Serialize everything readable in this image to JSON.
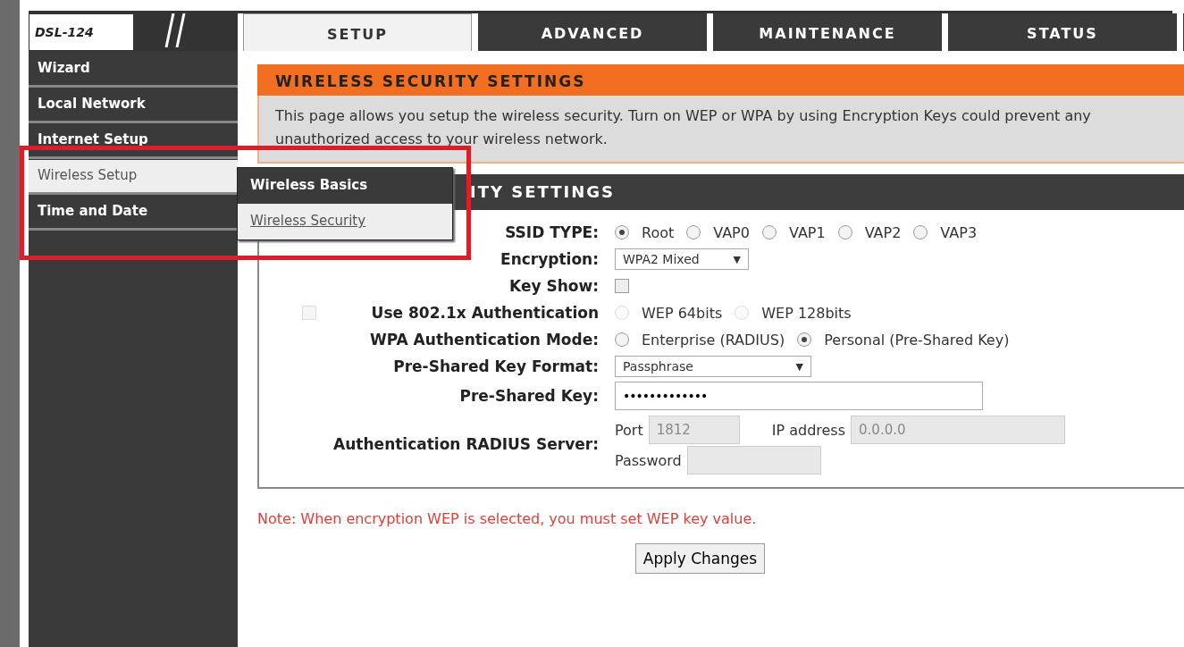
{
  "logo": {
    "model": "DSL-124"
  },
  "tabs": [
    {
      "label": "SETUP",
      "selected": true
    },
    {
      "label": "ADVANCED",
      "selected": false
    },
    {
      "label": "MAINTENANCE",
      "selected": false
    },
    {
      "label": "STATUS",
      "selected": false
    }
  ],
  "sidebar": {
    "items": [
      {
        "label": "Wizard",
        "selected": false
      },
      {
        "label": "Local Network",
        "selected": false
      },
      {
        "label": "Internet Setup",
        "selected": false
      },
      {
        "label": "Wireless Setup",
        "selected": true
      },
      {
        "label": "Time and Date",
        "selected": false
      }
    ]
  },
  "submenu": {
    "items": [
      {
        "label": "Wireless Basics",
        "selected": false
      },
      {
        "label": "Wireless Security",
        "selected": true
      }
    ]
  },
  "page_header": {
    "title": "WIRELESS SECURITY SETTINGS",
    "description": "This page allows you setup the wireless security. Turn on WEP or WPA by using Encryption Keys could prevent any unauthorized access to your wireless network."
  },
  "section": {
    "title": "ITY SETTINGS",
    "rows": [
      {
        "kind": "radios",
        "label": "SSID TYPE:",
        "options": [
          {
            "label": "Root",
            "selected": true,
            "disabled": false
          },
          {
            "label": "VAP0",
            "selected": false,
            "disabled": false
          },
          {
            "label": "VAP1",
            "selected": false,
            "disabled": false
          },
          {
            "label": "VAP2",
            "selected": false,
            "disabled": false
          },
          {
            "label": "VAP3",
            "selected": false,
            "disabled": false
          }
        ]
      },
      {
        "kind": "select",
        "label": "Encryption:",
        "value": "WPA2 Mixed",
        "arrow": "▼",
        "wide": false
      },
      {
        "kind": "checkbox",
        "label": "Key Show:",
        "checked": false,
        "disabled": false
      },
      {
        "kind": "radios",
        "label": "Use 802.1x Authentication",
        "check": {
          "checked": false,
          "disabled": true
        },
        "options": [
          {
            "label": "WEP 64bits",
            "selected": false,
            "disabled": true
          },
          {
            "label": "WEP 128bits",
            "selected": false,
            "disabled": true
          }
        ]
      },
      {
        "kind": "radios",
        "label": "WPA Authentication Mode:",
        "options": [
          {
            "label": "Enterprise (RADIUS)",
            "selected": false,
            "disabled": false
          },
          {
            "label": "Personal (Pre-Shared Key)",
            "selected": true,
            "disabled": false
          }
        ]
      },
      {
        "kind": "select",
        "label": "Pre-Shared Key Format:",
        "value": "Passphrase",
        "arrow": "▼",
        "wide": true
      },
      {
        "kind": "password",
        "label": "Pre-Shared Key:",
        "value": "•••••••••••••"
      },
      {
        "kind": "radius",
        "label": "Authentication RADIUS Server:",
        "port_label": "Port",
        "port": "1812",
        "ip_label": "IP address",
        "ip": "0.0.0.0",
        "password_label": "Password"
      }
    ]
  },
  "note": "Note: When encryption WEP is selected, you must set WEP key value.",
  "apply_button": "Apply Changes"
}
